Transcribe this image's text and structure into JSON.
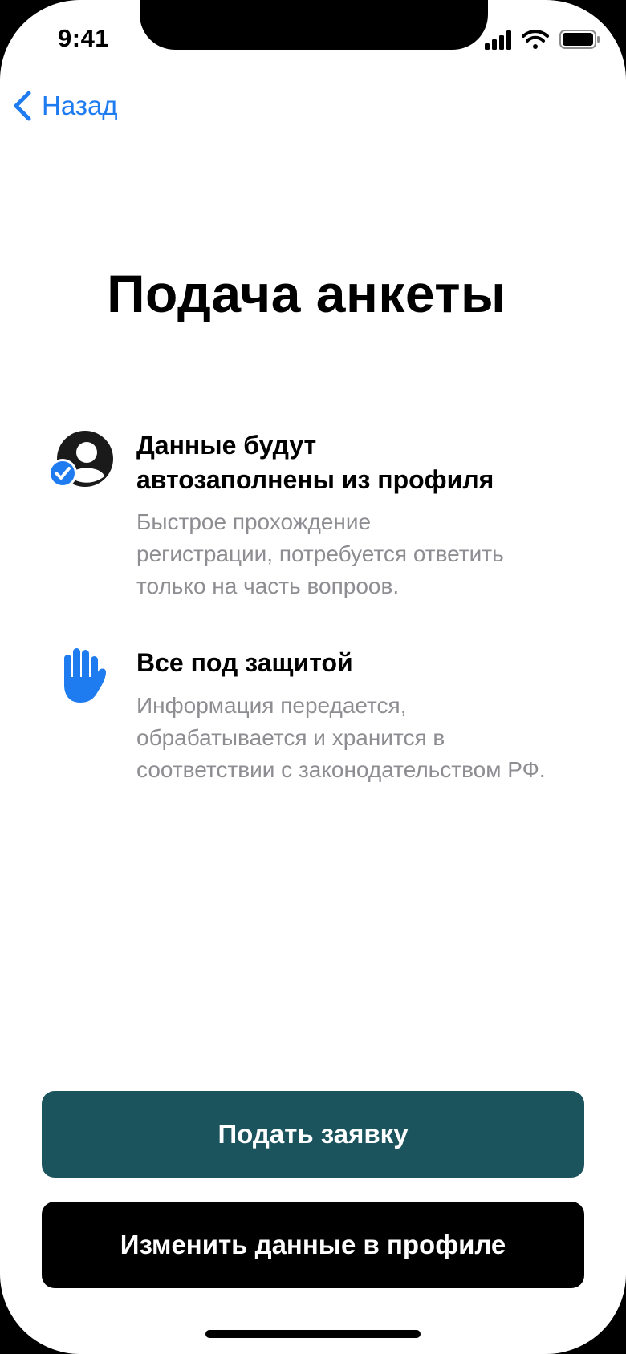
{
  "status_bar": {
    "time": "9:41"
  },
  "nav": {
    "back_label": "Назад"
  },
  "page": {
    "title": "Подача анкеты"
  },
  "features": [
    {
      "icon": "profile-check-icon",
      "title_line1": "Данные будут",
      "title_line2": "автозаполнены из профиля",
      "desc_line1": "Быстрое прохождение",
      "desc_line2": "регистрации, потребуется ответить",
      "desc_line3": "только на часть вопроов."
    },
    {
      "icon": "hand-stop-icon",
      "title_line1": "Все под защитой",
      "desc_line1": "Информация передается,",
      "desc_line2": "обрабатывается и хранится в",
      "desc_line3": "соответствии с законодательством РФ."
    }
  ],
  "actions": {
    "submit_label": "Подать заявку",
    "edit_profile_label": "Изменить данные в профиле"
  },
  "colors": {
    "accent_blue": "#1e7bf0",
    "primary_button": "#1c545e",
    "secondary_button": "#000000",
    "description_gray": "#8d8d92"
  }
}
